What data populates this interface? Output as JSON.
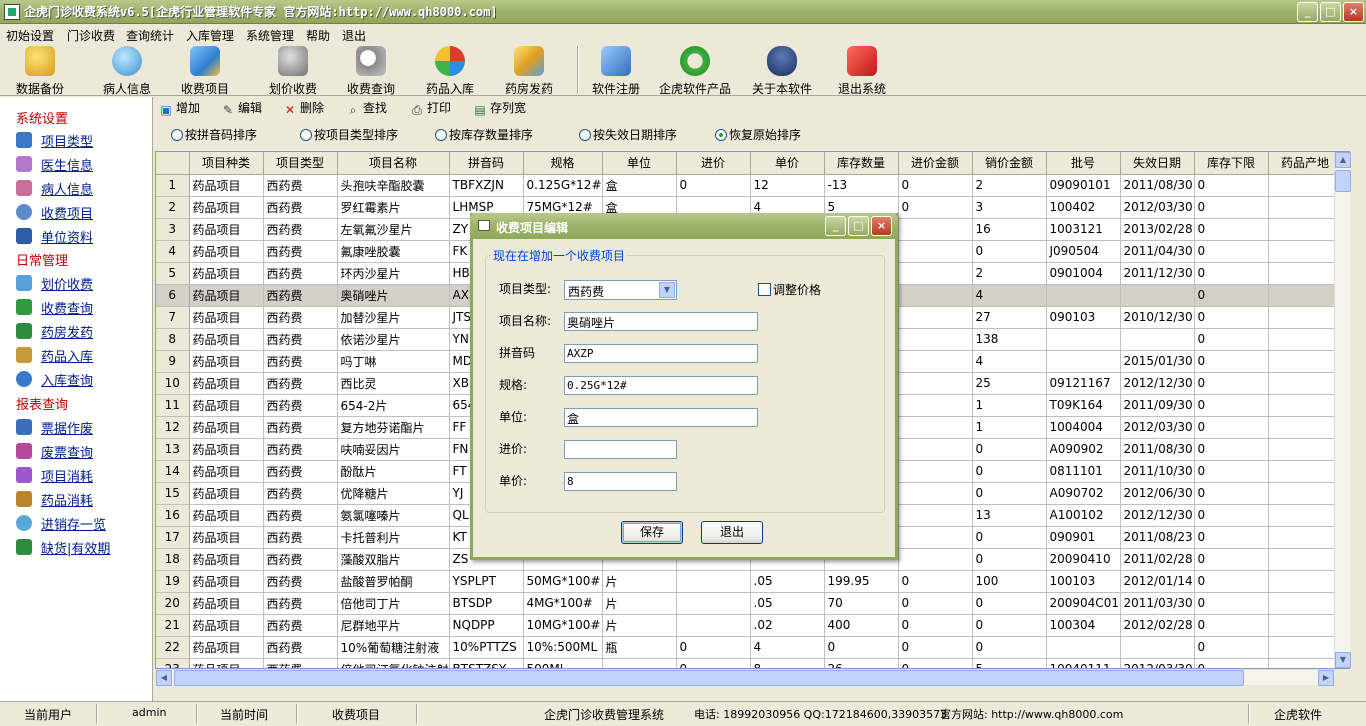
{
  "window": {
    "title": "企虎门诊收费系统v6.5[企虎行业管理软件专家 官方网站:http://www.qh8000.com]",
    "controls": {
      "minimize": "_",
      "maximize": "□",
      "close": "×"
    }
  },
  "menu": [
    "初始设置",
    "门诊收费",
    "查询统计",
    "入库管理",
    "系统管理",
    "帮助",
    "退出"
  ],
  "toolbar": [
    {
      "label": "数据备份",
      "icon": "database-backup-icon"
    },
    {
      "label": "病人信息",
      "icon": "patient-info-icon"
    },
    {
      "label": "收费项目",
      "icon": "charge-item-icon"
    },
    {
      "label": "划价收费",
      "icon": "pricing-icon"
    },
    {
      "label": "收费查询",
      "icon": "charge-query-icon"
    },
    {
      "label": "药品入库",
      "icon": "drug-stock-in-icon"
    },
    {
      "label": "药房发药",
      "icon": "pharmacy-dispense-icon"
    },
    {
      "label": "软件注册",
      "icon": "software-register-icon"
    },
    {
      "label": "企虎软件产品",
      "icon": "products-icon"
    },
    {
      "label": "关于本软件",
      "icon": "about-icon"
    },
    {
      "label": "退出系统",
      "icon": "exit-system-icon"
    }
  ],
  "sidebar": {
    "groups": [
      {
        "title": "系统设置",
        "items": [
          "项目类型",
          "医生信息",
          "病人信息",
          "收费项目",
          "单位资料"
        ]
      },
      {
        "title": "日常管理",
        "items": [
          "划价收费",
          "收费查询",
          "药房发药",
          "药品入库",
          "入库查询"
        ]
      },
      {
        "title": "报表查询",
        "items": [
          "票据作废",
          "废票查询",
          "项目消耗",
          "药品消耗",
          "进销存一览",
          "缺货|有效期"
        ]
      }
    ]
  },
  "actions": {
    "add": "增加",
    "edit": "编辑",
    "delete": "删除",
    "find": "查找",
    "print": "打印",
    "save_width": "存列宽"
  },
  "sort_options": [
    {
      "label": "按拼音码排序",
      "selected": false
    },
    {
      "label": "按项目类型排序",
      "selected": false
    },
    {
      "label": "按库存数量排序",
      "selected": false
    },
    {
      "label": "按失效日期排序",
      "selected": false
    },
    {
      "label": "恢复原始排序",
      "selected": true
    }
  ],
  "table": {
    "columns": [
      "",
      "项目种类",
      "项目类型",
      "项目名称",
      "拼音码",
      "规格",
      "单位",
      "进价",
      "单价",
      "库存数量",
      "进价金额",
      "销价金额",
      "批号",
      "失效日期",
      "库存下限",
      "药品产地"
    ],
    "selected_row": 6,
    "rows": [
      [
        "1",
        "药品项目",
        "西药费",
        "头孢呋辛酯胶囊",
        "TBFXZJN",
        "0.125G*12#",
        "盒",
        "0",
        "12",
        "-13",
        "0",
        "2",
        "09090101",
        "2011/08/30",
        "0",
        ""
      ],
      [
        "2",
        "药品项目",
        "西药费",
        "罗红霉素片",
        "LHMSP",
        "75MG*12#",
        "盒",
        "",
        "4",
        "5",
        "0",
        "3",
        "100402",
        "2012/03/30",
        "0",
        ""
      ],
      [
        "3",
        "药品项目",
        "西药费",
        "左氧氟沙星片",
        "ZY",
        "",
        "",
        "",
        "",
        "",
        "",
        "16",
        "1003121",
        "2013/02/28",
        "0",
        ""
      ],
      [
        "4",
        "药品项目",
        "西药费",
        "氟康唑胶囊",
        "FK",
        "",
        "",
        "",
        "",
        "",
        "",
        "0",
        "J090504",
        "2011/04/30",
        "0",
        ""
      ],
      [
        "5",
        "药品项目",
        "西药费",
        "环丙沙星片",
        "HB",
        "",
        "",
        "",
        "",
        "",
        "",
        "2",
        "0901004",
        "2011/12/30",
        "0",
        ""
      ],
      [
        "6",
        "药品项目",
        "西药费",
        "奥硝唑片",
        "AX",
        "",
        "",
        "",
        "",
        "",
        "",
        "4",
        "",
        "",
        "0",
        ""
      ],
      [
        "7",
        "药品项目",
        "西药费",
        "加替沙星片",
        "JTS",
        "",
        "",
        "",
        "",
        "",
        "",
        "27",
        "090103",
        "2010/12/30",
        "0",
        ""
      ],
      [
        "8",
        "药品项目",
        "西药费",
        "依诺沙星片",
        "YN",
        "",
        "",
        "",
        "",
        "",
        "",
        "138",
        "",
        "",
        "0",
        ""
      ],
      [
        "9",
        "药品项目",
        "西药费",
        "吗丁啉",
        "MD",
        "",
        "",
        "",
        "",
        "",
        "",
        "4",
        "",
        "2015/01/30",
        "0",
        ""
      ],
      [
        "10",
        "药品项目",
        "西药费",
        "西比灵",
        "XB",
        "",
        "",
        "",
        "",
        "",
        "",
        "25",
        "09121167",
        "2012/12/30",
        "0",
        ""
      ],
      [
        "11",
        "药品项目",
        "西药费",
        "654-2片",
        "654",
        "",
        "",
        "",
        "",
        "",
        "",
        "1",
        "T09K164",
        "2011/09/30",
        "0",
        ""
      ],
      [
        "12",
        "药品项目",
        "西药费",
        "复方地芬诺酯片",
        "FF",
        "",
        "",
        "",
        "",
        "",
        "",
        "1",
        "1004004",
        "2012/03/30",
        "0",
        ""
      ],
      [
        "13",
        "药品项目",
        "西药费",
        "呋喃妥因片",
        "FN",
        "",
        "",
        "",
        "",
        "",
        "",
        "0",
        "A090902",
        "2011/08/30",
        "0",
        ""
      ],
      [
        "14",
        "药品项目",
        "西药费",
        "酚酞片",
        "FT",
        "",
        "",
        "",
        "",
        "",
        "",
        "0",
        "0811101",
        "2011/10/30",
        "0",
        ""
      ],
      [
        "15",
        "药品项目",
        "西药费",
        "优降糖片",
        "YJ",
        "",
        "",
        "",
        "",
        "",
        "",
        "0",
        "A090702",
        "2012/06/30",
        "0",
        ""
      ],
      [
        "16",
        "药品项目",
        "西药费",
        "氨氯噻嗪片",
        "QL",
        "",
        "",
        "",
        "",
        "",
        "",
        "13",
        "A100102",
        "2012/12/30",
        "0",
        ""
      ],
      [
        "17",
        "药品项目",
        "西药费",
        "卡托普利片",
        "KT",
        "",
        "",
        "",
        "",
        "",
        "",
        "0",
        "090901",
        "2011/08/23",
        "0",
        ""
      ],
      [
        "18",
        "药品项目",
        "西药费",
        "藻酸双脂片",
        "ZS",
        "",
        "",
        "",
        "",
        "",
        "",
        "0",
        "20090410",
        "2011/02/28",
        "0",
        ""
      ],
      [
        "19",
        "药品项目",
        "西药费",
        "盐酸普罗帕酮",
        "YSPLPT",
        "50MG*100#",
        "片",
        "",
        ".05",
        "199.95",
        "0",
        "100",
        "100103",
        "2012/01/14",
        "0",
        ""
      ],
      [
        "20",
        "药品项目",
        "西药费",
        "倍他司丁片",
        "BTSDP",
        "4MG*100#",
        "片",
        "",
        ".05",
        "70",
        "0",
        "0",
        "200904C01",
        "2011/03/30",
        "0",
        ""
      ],
      [
        "21",
        "药品项目",
        "西药费",
        "尼群地平片",
        "NQDPP",
        "10MG*100#",
        "片",
        "",
        ".02",
        "400",
        "0",
        "0",
        "100304",
        "2012/02/28",
        "0",
        ""
      ],
      [
        "22",
        "药品项目",
        "西药费",
        "10%葡萄糖注射液",
        "10%PTTZS",
        "10%:500ML",
        "瓶",
        "0",
        "4",
        "0",
        "0",
        "0",
        "",
        "",
        "0",
        ""
      ],
      [
        "23",
        "药品项目",
        "西药费",
        "倍他司汀氯化钠注射",
        "BTSTZSY",
        "500ML",
        "",
        "0",
        "8",
        "26",
        "0",
        "5",
        "10040111",
        "2012/03/30",
        "0",
        ""
      ]
    ]
  },
  "dialog": {
    "title": "收费项目编辑",
    "group_label": "现在在增加一个收费项目",
    "type_label": "项目类型:",
    "type_value": "西药费",
    "adjust_price_label": "调整价格",
    "name_label": "项目名称:",
    "name_value": "奥硝唑片",
    "pinyin_label": "拼音码",
    "pinyin_value": "AXZP",
    "spec_label": "规格:",
    "spec_value": "0.25G*12#",
    "unit_label": "单位:",
    "unit_value": "盒",
    "cost_label": "进价:",
    "cost_value": "",
    "price_label": "单价:",
    "price_value": "8",
    "save_label": "保存",
    "exit_label": "退出"
  },
  "status": {
    "user_label": "当前用户",
    "user_value": "admin",
    "time_label": "当前时间",
    "module": "收费项目",
    "system": "企虎门诊收费管理系统",
    "contact": "电话: 18992030956 QQ:172184600,33903573",
    "website": "官方网站: http://www.qh8000.com",
    "brand": "企虎软件"
  },
  "colors": {
    "titlebar": "#9db36a",
    "section_heading": "#c00000",
    "link": "#00208a",
    "legend": "#0046d5"
  }
}
